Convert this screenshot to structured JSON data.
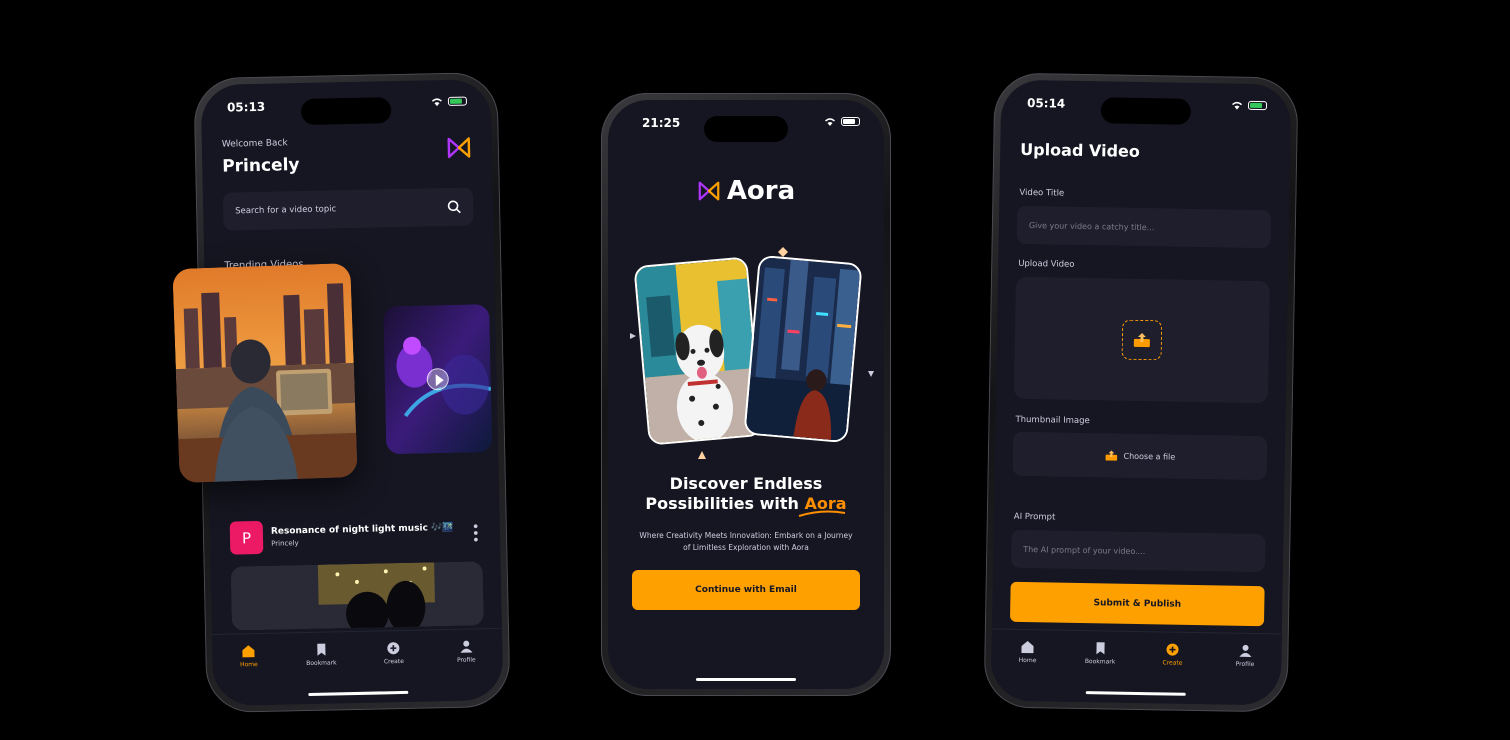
{
  "colors": {
    "accent": "#ffa001",
    "background": "#161622",
    "field": "#1e1e2d",
    "avatar": "#ec1a65",
    "battery": "#34c759"
  },
  "home_screen": {
    "status_time": "05:13",
    "welcome": "Welcome Back",
    "user_name": "Princely",
    "search_placeholder": "Search for a video topic",
    "trending_label": "Trending Videos",
    "post": {
      "avatar_letter": "P",
      "title": "Resonance of night light music 🎶🌃",
      "author": "Princely"
    },
    "tabs": [
      "Home",
      "Bookmark",
      "Create",
      "Profile"
    ],
    "active_tab": "Home"
  },
  "onboarding_screen": {
    "status_time": "21:25",
    "brand": "Aora",
    "headline_line1": "Discover Endless",
    "headline_line2_prefix": "Possibilities with ",
    "headline_accent": "Aora",
    "subtext": "Where Creativity Meets Innovation: Embark on a Journey of Limitless Exploration with Aora",
    "button": "Continue with Email"
  },
  "upload_screen": {
    "status_time": "05:14",
    "title": "Upload Video",
    "video_title_label": "Video Title",
    "video_title_placeholder": "Give your video a catchy title...",
    "upload_video_label": "Upload Video",
    "thumbnail_label": "Thumbnail Image",
    "choose_file": "Choose a file",
    "ai_prompt_label": "AI Prompt",
    "ai_prompt_placeholder": "The AI prompt of your video....",
    "submit_button": "Submit & Publish",
    "tabs": [
      "Home",
      "Bookmark",
      "Create",
      "Profile"
    ],
    "active_tab": "Create"
  }
}
